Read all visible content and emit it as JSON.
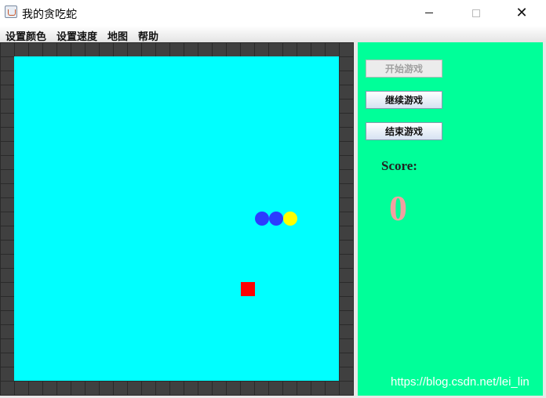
{
  "window": {
    "title": "我的贪吃蛇",
    "icon": "java-cup-icon",
    "controls": {
      "minimize": "minimize-icon",
      "maximize": "maximize-icon",
      "close": "✕"
    }
  },
  "menubar": {
    "items": [
      {
        "label": "设置颜色"
      },
      {
        "label": "设置速度"
      },
      {
        "label": "地图"
      },
      {
        "label": "帮助"
      }
    ]
  },
  "board": {
    "wall_color": "#404040",
    "field_color": "#00ffff",
    "snake": [
      {
        "role": "body",
        "color": "#2b3cff"
      },
      {
        "role": "body",
        "color": "#2b3cff"
      },
      {
        "role": "head",
        "color": "#ffff00"
      }
    ],
    "food": {
      "color": "#ff0000"
    }
  },
  "panel": {
    "background": "#00ff99",
    "buttons": [
      {
        "label": "开始游戏",
        "enabled": false
      },
      {
        "label": "继续游戏",
        "enabled": true
      },
      {
        "label": "结束游戏",
        "enabled": true
      }
    ],
    "score_label": "Score:",
    "score_value": "0"
  },
  "watermark": "https://blog.csdn.net/lei_lin"
}
